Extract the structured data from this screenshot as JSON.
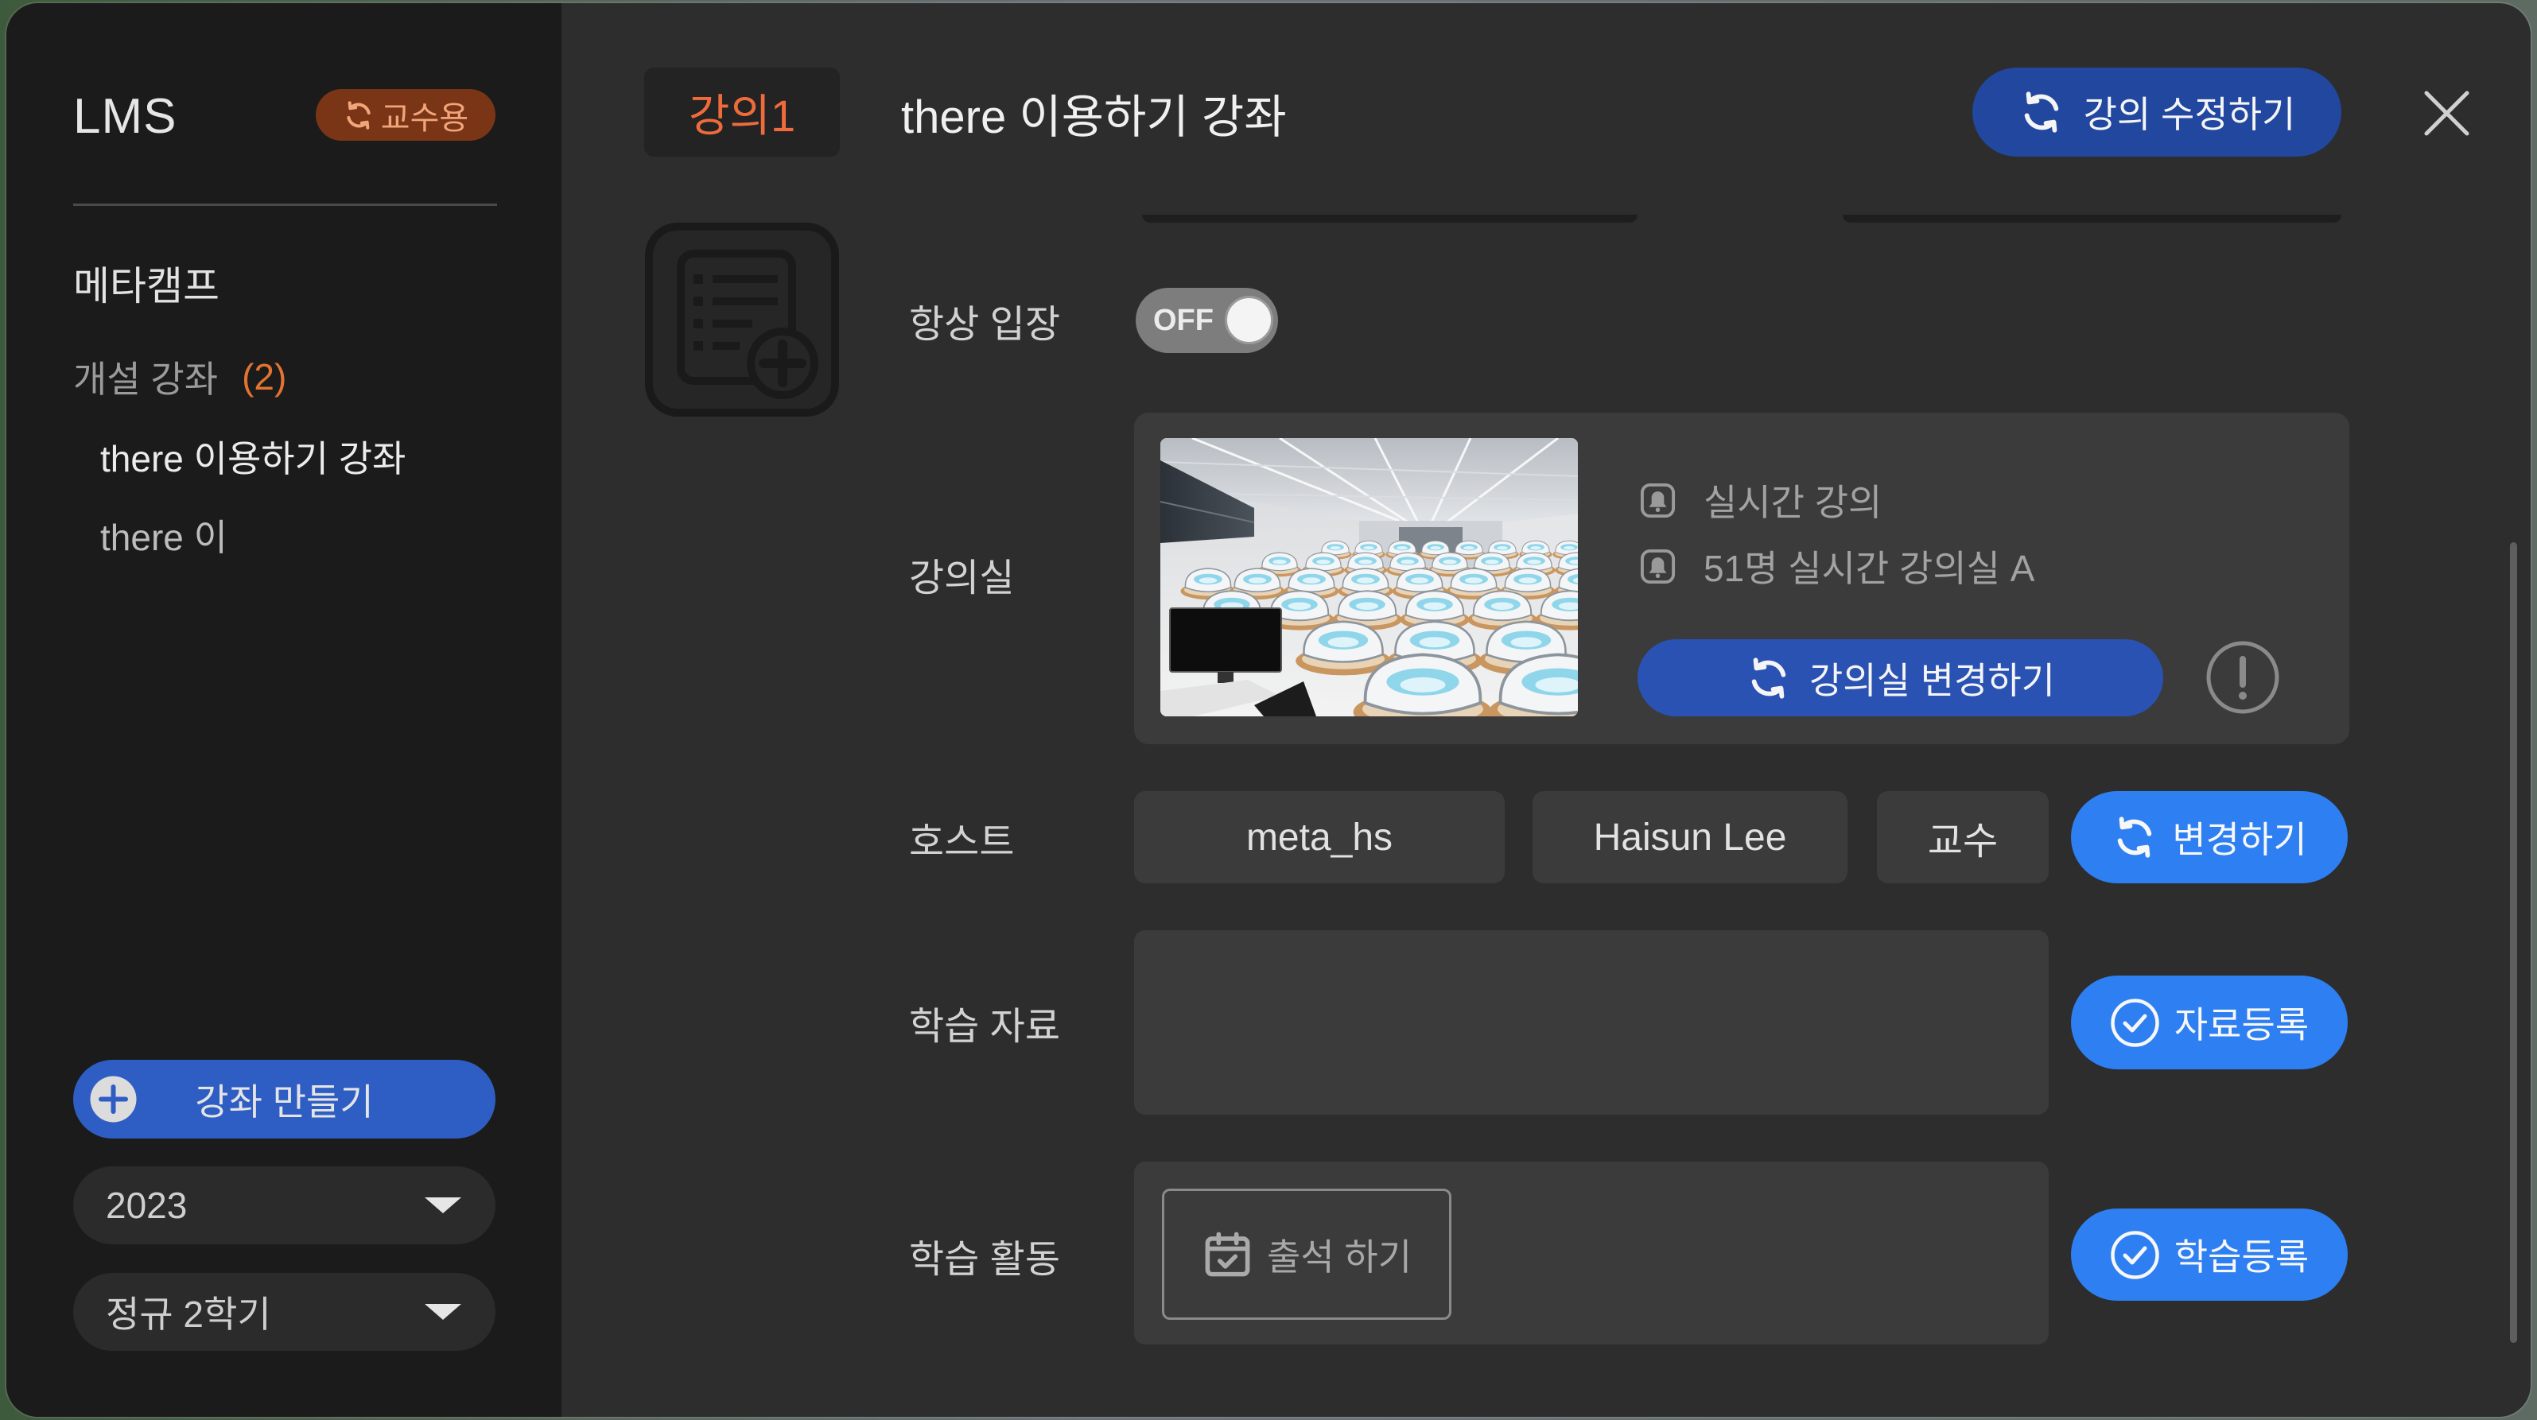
{
  "sidebar": {
    "app_title": "LMS",
    "role_badge": "교수용",
    "org_name": "메타캠프",
    "open_courses_label": "개설 강좌",
    "open_courses_count": "(2)",
    "courses": [
      {
        "label": "there 이용하기 강좌"
      },
      {
        "label": "there 이"
      }
    ],
    "create_course_label": "강좌 만들기",
    "year_select": {
      "selected": "2023"
    },
    "term_select": {
      "selected": "정규 2학기"
    }
  },
  "header": {
    "tab_label": "강의1",
    "course_title": "there 이용하기 강좌",
    "edit_button_label": "강의 수정하기"
  },
  "form": {
    "always_enter": {
      "label": "항상 입장",
      "toggle_text": "OFF",
      "is_on": false
    },
    "classroom": {
      "label": "강의실",
      "lecture_type": "실시간 강의",
      "room_name": "51명 실시간 강의실 A",
      "change_button_label": "강의실 변경하기"
    },
    "host": {
      "label": "호스트",
      "user_id": "meta_hs",
      "name": "Haisun Lee",
      "role": "교수",
      "change_button_label": "변경하기"
    },
    "materials": {
      "label": "학습 자료",
      "register_button_label": "자료등록"
    },
    "activities": {
      "label": "학습 활동",
      "attendance_button_label": "출석 하기",
      "register_button_label": "학습등록"
    }
  },
  "icons": {
    "role_badge": "refresh-icon",
    "create_course": "plus-circle-icon",
    "select": "caret-down-icon",
    "edit_button": "refresh-icon",
    "close": "close-icon",
    "course_icon": "list-add-icon",
    "classroom_info": "bell-icon",
    "classroom_help": "alert-circle-icon",
    "change_buttons": "refresh-icon",
    "register_buttons": "check-circle-icon",
    "attendance": "calendar-check-icon"
  },
  "colors": {
    "sidebar_bg": "#1b1b1b",
    "content_bg": "#2d2d2d",
    "panel_bg": "#3b3b3b",
    "accent_orange": "#ef6b3b",
    "badge_bg": "#7a3516",
    "primary_blue": "#2d7ff2",
    "dark_blue": "#2a52b3",
    "navy_blue": "#21479f",
    "toggle_off": "#7d7d7d"
  }
}
